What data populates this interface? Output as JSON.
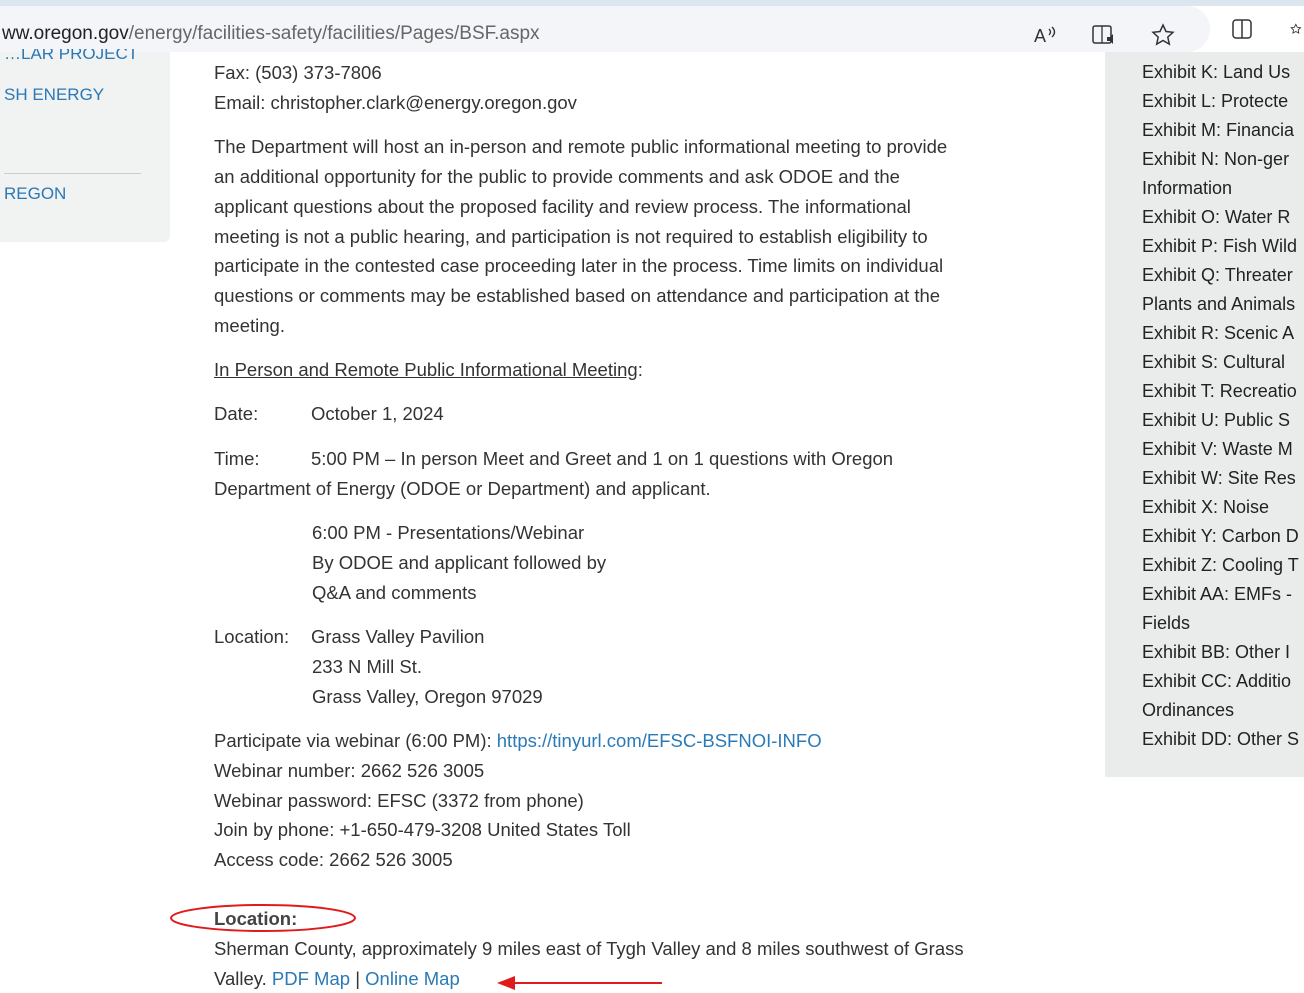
{
  "browser": {
    "url_prefix": "ww.oregon.gov",
    "url_path": "/energy/facilities-safety/facilities/Pages/BSF.aspx",
    "read_aloud_icon": "read-aloud-icon",
    "immersive_reader_icon": "immersive-reader-icon",
    "favorite_icon": "star-icon",
    "split_screen_icon": "split-screen-icon"
  },
  "left_nav": {
    "items": [
      "…LAR PROJECT",
      "SH ENERGY",
      "REGON"
    ]
  },
  "contact": {
    "fax": "Fax: (503) 373-7806",
    "email": "Email: christopher.clark@energy.oregon.gov"
  },
  "intro_lines": [
    "The Department will host an in-person and remote public informational meeting to provide",
    "an additional opportunity for the public to provide comments and ask ODOE and the",
    "applicant questions about the proposed facility and review process. The informational",
    "meeting is not a public hearing, and participation is not required to establish eligibility to",
    "participate in the contested case proceeding later in the process. Time limits on individual",
    "questions or comments may be established based on attendance and participation at the",
    "meeting."
  ],
  "meeting": {
    "heading": "In Person and Remote Public Informational Meeting",
    "heading_colon": ":",
    "date_label": "Date:",
    "date_value": "October 1, 2024",
    "time_label": "Time:",
    "time_line1": "5:00 PM – In person Meet and Greet and 1 on 1 questions with Oregon",
    "time_line2": "Department of Energy (ODOE or Department) and applicant.",
    "time_sub": [
      "6:00 PM - Presentations/Webinar",
      "By ODOE and applicant followed by",
      "Q&A and comments"
    ],
    "location_label": "Location:",
    "location_lines": [
      "Grass Valley Pavilion",
      "233 N Mill St.",
      "Grass Valley, Oregon 97029"
    ]
  },
  "webinar": {
    "participate_text": "Participate via webinar (6:00 PM): ",
    "participate_link": "https://tinyurl.com/EFSC-BSFNOI-INFO",
    "number": "Webinar number:  2662 526 3005",
    "password": "Webinar password: EFSC (3372 from phone)",
    "phone": "Join by phone: +1-650-479-3208 United States Toll",
    "access": "Access code: 2662 526 3005"
  },
  "location_section": {
    "heading": "Location:",
    "line1": "Sherman County, approximately 9 miles east of Tygh Valley and 8 miles southwest of Grass",
    "line2_prefix": "Valley. ",
    "pdf_map": "PDF Map",
    "separator": " | ",
    "online_map": "Online Map"
  },
  "exhibits": [
    "Exhibit K: Land Us",
    "Exhibit L: Protecte",
    "Exhibit M: Financia",
    "Exhibit N: Non-ger",
    "Information",
    "Exhibit O: Water R",
    "Exhibit P: Fish Wild",
    "Exhibit Q: Threater",
    "Plants and Animals",
    "Exhibit R: Scenic A",
    "Exhibit S: Cultural",
    "Exhibit T: Recreatio",
    "Exhibit U: Public S",
    "Exhibit V: Waste M",
    "Exhibit W: Site Res",
    "Exhibit X: Noise",
    "Exhibit Y: Carbon D",
    "Exhibit Z: Cooling T",
    "Exhibit AA: EMFs -",
    "Fields",
    "Exhibit BB: Other I",
    "Exhibit CC: Additio",
    "Ordinances",
    "Exhibit DD: Other S"
  ],
  "annotation_color": "#e01b1b"
}
